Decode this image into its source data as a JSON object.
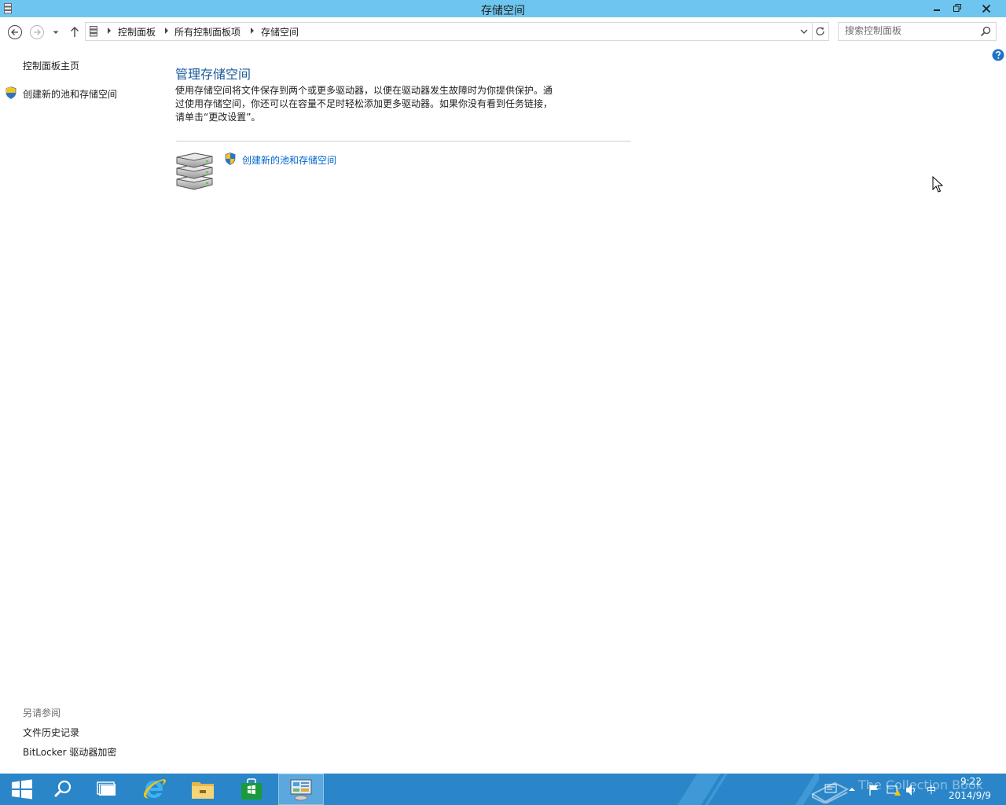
{
  "window": {
    "title": "存储空间",
    "controls": {
      "minimize": "minimize-icon",
      "maximize": "restore-icon",
      "close": "close-icon"
    }
  },
  "address_bar": {
    "breadcrumbs": [
      "控制面板",
      "所有控制面板项",
      "存储空间"
    ],
    "search_placeholder": "搜索控制面板"
  },
  "left_pane": {
    "home_link": "控制面板主页",
    "create_link": "创建新的池和存储空间",
    "see_also_title": "另请参阅",
    "see_also": [
      "文件历史记录",
      "BitLocker 驱动器加密"
    ]
  },
  "main": {
    "heading": "管理存储空间",
    "description": "使用存储空间将文件保存到两个或更多驱动器，以便在驱动器发生故障时为你提供保护。通过使用存储空间，你还可以在容量不足时轻松添加更多驱动器。如果你没有看到任务链接，请单击“更改设置”。",
    "action_link": "创建新的池和存储空间"
  },
  "taskbar": {
    "items": [
      "start-icon",
      "search-icon",
      "task-view-icon",
      "internet-explorer-icon",
      "file-explorer-icon",
      "store-icon",
      "control-panel-icon"
    ],
    "active_item": "control-panel-icon",
    "watermark": "The Collection Book",
    "time": "9:22",
    "date": "2014/9/9",
    "ime": "中"
  },
  "colors": {
    "titlebar": "#6ec6f0",
    "taskbar": "#2a86c8",
    "link": "#0066cc",
    "heading": "#1d5a9c"
  }
}
